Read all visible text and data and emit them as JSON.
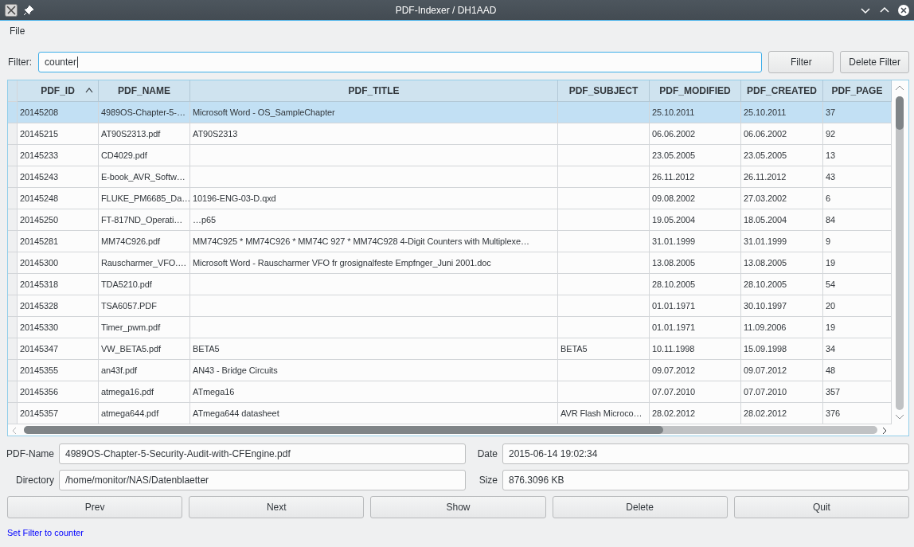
{
  "window": {
    "title": "PDF-Indexer / DH1AAD"
  },
  "menu": [
    "File"
  ],
  "filter": {
    "label": "Filter:",
    "value": "counter",
    "buttons": [
      "Filter",
      "Delete Filter"
    ]
  },
  "table": {
    "columns": [
      {
        "label": "PDF_ID",
        "sorted": true
      },
      {
        "label": "PDF_NAME",
        "sorted": false
      },
      {
        "label": "PDF_TITLE",
        "sorted": false
      },
      {
        "label": "PDF_SUBJECT",
        "sorted": false
      },
      {
        "label": "PDF_MODIFIED",
        "sorted": false
      },
      {
        "label": "PDF_CREATED",
        "sorted": false
      },
      {
        "label": "PDF_PAGE",
        "sorted": false
      }
    ],
    "rows": [
      {
        "selected": true,
        "cells": [
          "20145208",
          "4989OS-Chapter-5-…",
          "Microsoft Word - OS_SampleChapter",
          "",
          "25.10.2011",
          "25.10.2011",
          "37"
        ]
      },
      {
        "selected": false,
        "cells": [
          "20145215",
          "AT90S2313.pdf",
          "AT90S2313",
          "",
          "06.06.2002",
          "06.06.2002",
          "92"
        ]
      },
      {
        "selected": false,
        "cells": [
          "20145233",
          "CD4029.pdf",
          "",
          "",
          "23.05.2005",
          "23.05.2005",
          "13"
        ]
      },
      {
        "selected": false,
        "cells": [
          "20145243",
          "E-book_AVR_Softw…",
          "",
          "",
          "26.11.2012",
          "26.11.2012",
          "43"
        ]
      },
      {
        "selected": false,
        "cells": [
          "20145248",
          "FLUKE_PM6685_Da…",
          "10196-ENG-03-D.qxd",
          "",
          "09.08.2002",
          "27.03.2002",
          "6"
        ]
      },
      {
        "selected": false,
        "cells": [
          "20145250",
          "FT-817ND_Operati…",
          "…p65",
          "",
          "19.05.2004",
          "18.05.2004",
          "84"
        ]
      },
      {
        "selected": false,
        "cells": [
          "20145281",
          "MM74C926.pdf",
          "MM74C925 * MM74C926 * MM74C 927 * MM74C928 4-Digit Counters with Multiplexe…",
          "",
          "31.01.1999",
          "31.01.1999",
          "9"
        ]
      },
      {
        "selected": false,
        "cells": [
          "20145300",
          "Rauscharmer_VFO.…",
          "Microsoft Word - Rauscharmer VFO fr grosignalfeste Empfnger_Juni 2001.doc",
          "",
          "13.08.2005",
          "13.08.2005",
          "19"
        ]
      },
      {
        "selected": false,
        "cells": [
          "20145318",
          "TDA5210.pdf",
          "",
          "",
          "28.10.2005",
          "28.10.2005",
          "54"
        ]
      },
      {
        "selected": false,
        "cells": [
          "20145328",
          "TSA6057.PDF",
          "",
          "",
          "01.01.1971",
          "30.10.1997",
          "20"
        ]
      },
      {
        "selected": false,
        "cells": [
          "20145330",
          "Timer_pwm.pdf",
          "",
          "",
          "01.01.1971",
          "11.09.2006",
          "19"
        ]
      },
      {
        "selected": false,
        "cells": [
          "20145347",
          "VW_BETA5.pdf",
          "BETA5",
          "BETA5",
          "10.11.1998",
          "15.09.1998",
          "34"
        ]
      },
      {
        "selected": false,
        "cells": [
          "20145355",
          "an43f.pdf",
          "AN43 - Bridge Circuits",
          "",
          "09.07.2012",
          "09.07.2012",
          "48"
        ]
      },
      {
        "selected": false,
        "cells": [
          "20145356",
          "atmega16.pdf",
          "ATmega16",
          "",
          "07.07.2010",
          "07.07.2010",
          "357"
        ]
      },
      {
        "selected": false,
        "cells": [
          "20145357",
          "atmega644.pdf",
          "ATmega644 datasheet",
          "AVR Flash Microco…",
          "28.02.2012",
          "28.02.2012",
          "376"
        ]
      }
    ]
  },
  "details": [
    {
      "label": "PDF-Name",
      "value": "4989OS-Chapter-5-Security-Audit-with-CFEngine.pdf"
    },
    {
      "label": "Date",
      "value": "2015-06-14 19:02:34"
    },
    {
      "label": "Directory",
      "value": "/home/monitor/NAS/Datenblaetter"
    },
    {
      "label": "Size",
      "value": "876.3096 KB"
    }
  ],
  "buttons": [
    "Prev",
    "Next",
    "Show",
    "Delete",
    "Quit"
  ],
  "status_bar": "Set Filter to counter"
}
